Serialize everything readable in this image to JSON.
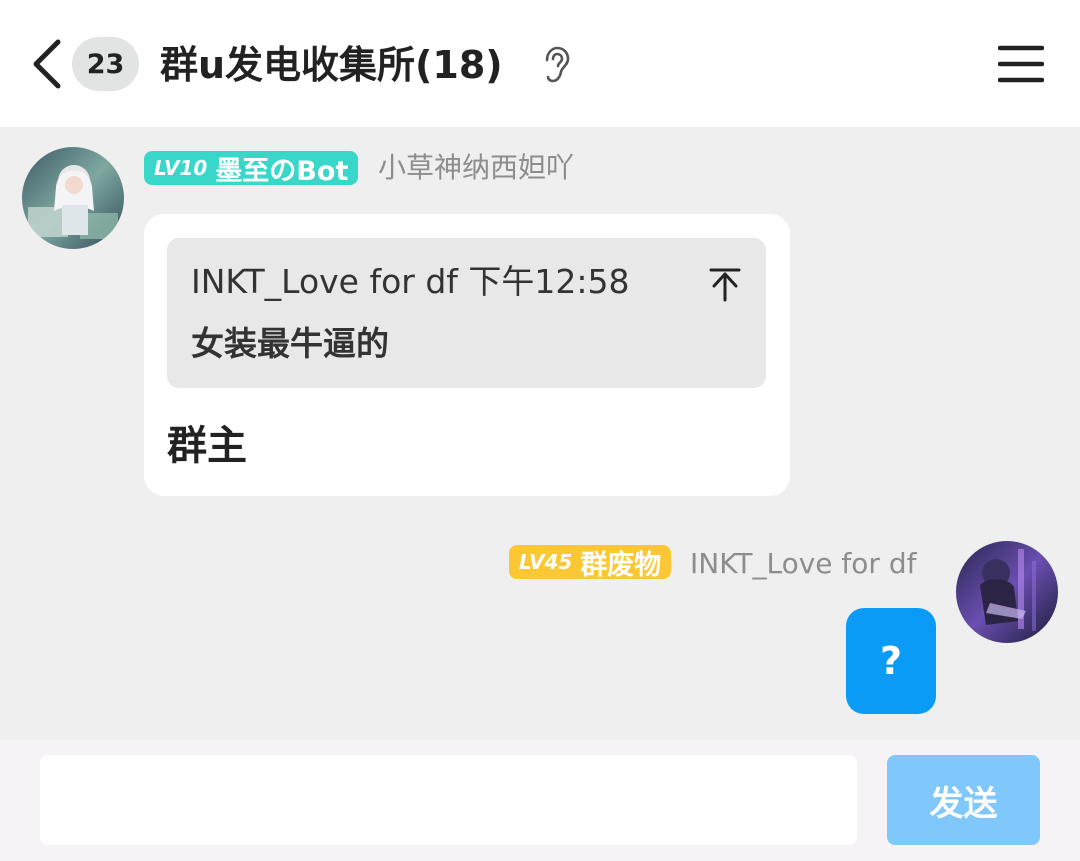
{
  "header": {
    "unread_count": "23",
    "group_title": "群u发电收集所(18)"
  },
  "messages": [
    {
      "side": "left",
      "level": "LV10",
      "honor_title": "墨至のBot",
      "sender": "小草神纳西妲吖",
      "quote": {
        "author_time": "INKT_Love for df 下午12:58",
        "text": "女装最牛逼的"
      },
      "text": "群主"
    },
    {
      "side": "right",
      "level": "LV45",
      "honor_title": "群废物",
      "sender": "INKT_Love for df",
      "text": "?"
    }
  ],
  "input": {
    "value": "",
    "placeholder": "",
    "send_label": "发送"
  },
  "colors": {
    "accent": "#0a9bf7",
    "send_disabled": "#80c8fc",
    "bot_tag": "#38d7c9",
    "member_tag": "#fcc735",
    "background": "#efeff0"
  },
  "icons": {
    "back": "chevron-left-icon",
    "listen": "ear-icon",
    "menu": "hamburger-menu-icon",
    "jump_to_quote": "jump-to-top-icon"
  }
}
